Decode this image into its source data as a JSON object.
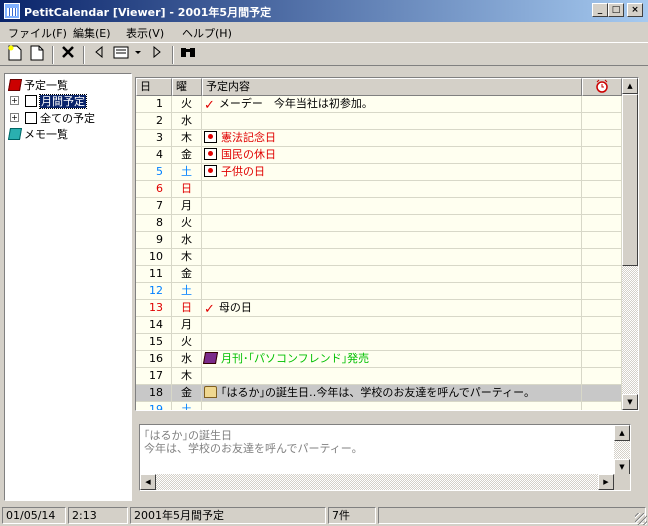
{
  "window": {
    "title": "PetitCalendar [Viewer] - 2001年5月間予定",
    "minimize": "_",
    "maximize": "□",
    "close": "×"
  },
  "menu": [
    "ファイル(F)",
    "編集(E)",
    "表示(V)",
    "ヘルプ(H)"
  ],
  "tree": {
    "root": "予定一覧",
    "monthly": "月間予定",
    "all": "全ての予定",
    "memo": "メモ一覧"
  },
  "grid": {
    "headers": {
      "day": "日",
      "weekday": "曜",
      "content": "予定内容"
    },
    "rows": [
      {
        "day": "1",
        "weekday": "火",
        "content": "メーデー　今年当社は初参加。",
        "mark": "check",
        "color": ""
      },
      {
        "day": "2",
        "weekday": "水",
        "content": "",
        "mark": "",
        "color": ""
      },
      {
        "day": "3",
        "weekday": "木",
        "content": "憲法記念日",
        "mark": "flag",
        "color": "red"
      },
      {
        "day": "4",
        "weekday": "金",
        "content": "国民の休日",
        "mark": "flag",
        "color": "red"
      },
      {
        "day": "5",
        "weekday": "土",
        "content": "子供の日",
        "mark": "flag",
        "color": "red",
        "daycolor": "blue"
      },
      {
        "day": "6",
        "weekday": "日",
        "content": "",
        "mark": "",
        "color": "",
        "daycolor": "red"
      },
      {
        "day": "7",
        "weekday": "月",
        "content": "",
        "mark": "",
        "color": ""
      },
      {
        "day": "8",
        "weekday": "火",
        "content": "",
        "mark": "",
        "color": ""
      },
      {
        "day": "9",
        "weekday": "水",
        "content": "",
        "mark": "",
        "color": ""
      },
      {
        "day": "10",
        "weekday": "木",
        "content": "",
        "mark": "",
        "color": ""
      },
      {
        "day": "11",
        "weekday": "金",
        "content": "",
        "mark": "",
        "color": ""
      },
      {
        "day": "12",
        "weekday": "土",
        "content": "",
        "mark": "",
        "color": "",
        "daycolor": "blue"
      },
      {
        "day": "13",
        "weekday": "日",
        "content": "母の日",
        "mark": "check",
        "color": "",
        "daycolor": "red"
      },
      {
        "day": "14",
        "weekday": "月",
        "content": "",
        "mark": "",
        "color": ""
      },
      {
        "day": "15",
        "weekday": "火",
        "content": "",
        "mark": "",
        "color": ""
      },
      {
        "day": "16",
        "weekday": "水",
        "content": "月刊･｢パソコンフレンド｣発売",
        "mark": "book",
        "color": "green"
      },
      {
        "day": "17",
        "weekday": "木",
        "content": "",
        "mark": "",
        "color": ""
      },
      {
        "day": "18",
        "weekday": "金",
        "content": "｢はるか｣の誕生日‥今年は、学校のお友達を呼んでパーティー。",
        "mark": "cake",
        "color": "",
        "selected": true
      },
      {
        "day": "19",
        "weekday": "土",
        "content": "",
        "mark": "",
        "color": "",
        "daycolor": "blue"
      }
    ]
  },
  "memo": {
    "text": "｢はるか｣の誕生日\n今年は、学校のお友達を呼んでパーティー。"
  },
  "status": {
    "date": "01/05/14",
    "time": "2:13",
    "view": "2001年5月間予定",
    "count": "7件"
  }
}
